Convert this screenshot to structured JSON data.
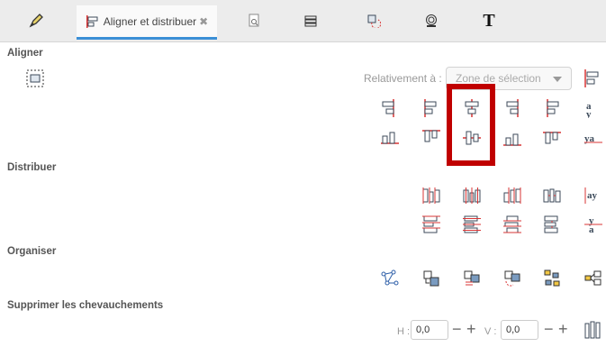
{
  "tabs": {
    "align_label": "Aligner et distribuer",
    "close_symbol": "✖",
    "text_tool_label": "T"
  },
  "sections": {
    "aligner": "Aligner",
    "distribuer": "Distribuer",
    "organiser": "Organiser",
    "chevauchements": "Supprimer les chevauchements"
  },
  "relative": {
    "label": "Relativement à :",
    "value": "Zone de sélection"
  },
  "overlap": {
    "h_label": "H :",
    "h_value": "0,0",
    "v_label": "V :",
    "v_value": "0,0",
    "minus": "−",
    "plus": "+"
  },
  "colors": {
    "accent_tab": "#3b8fd6",
    "highlight": "#c00000",
    "icon_red": "#d93434",
    "icon_dark": "#3c4a5a"
  }
}
